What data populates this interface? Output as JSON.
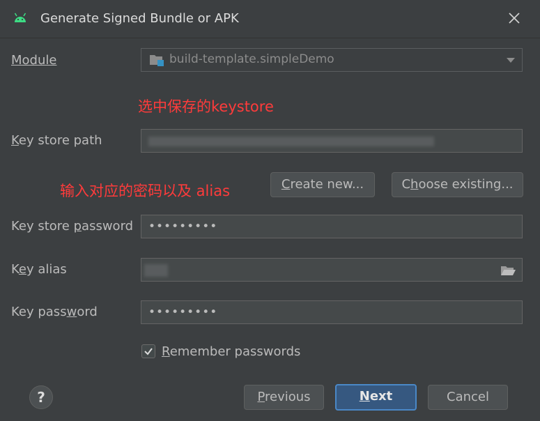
{
  "window": {
    "title": "Generate Signed Bundle or APK"
  },
  "form": {
    "module_label": "Module",
    "module_value": "build-template.simpleDemo",
    "keystore_path_label": "Key store path",
    "keystore_password_label": "Key store password",
    "keystore_password_value": "•••••••••",
    "key_alias_label": "Key alias",
    "key_password_label": "Key password",
    "key_password_value": "•••••••••",
    "remember_label": "Remember passwords",
    "remember_checked": true
  },
  "buttons": {
    "create_new": "Create new...",
    "choose_existing": "Choose existing...",
    "help": "?",
    "previous": "Previous",
    "next": "Next",
    "cancel": "Cancel"
  },
  "annotations": {
    "select_keystore": "选中保存的keystore",
    "enter_password": "输入对应的密码以及 alias"
  },
  "colors": {
    "background": "#3c3f41",
    "annotation": "#ff3b3b",
    "primary_button": "#365880",
    "android_green": "#3ddc84"
  }
}
